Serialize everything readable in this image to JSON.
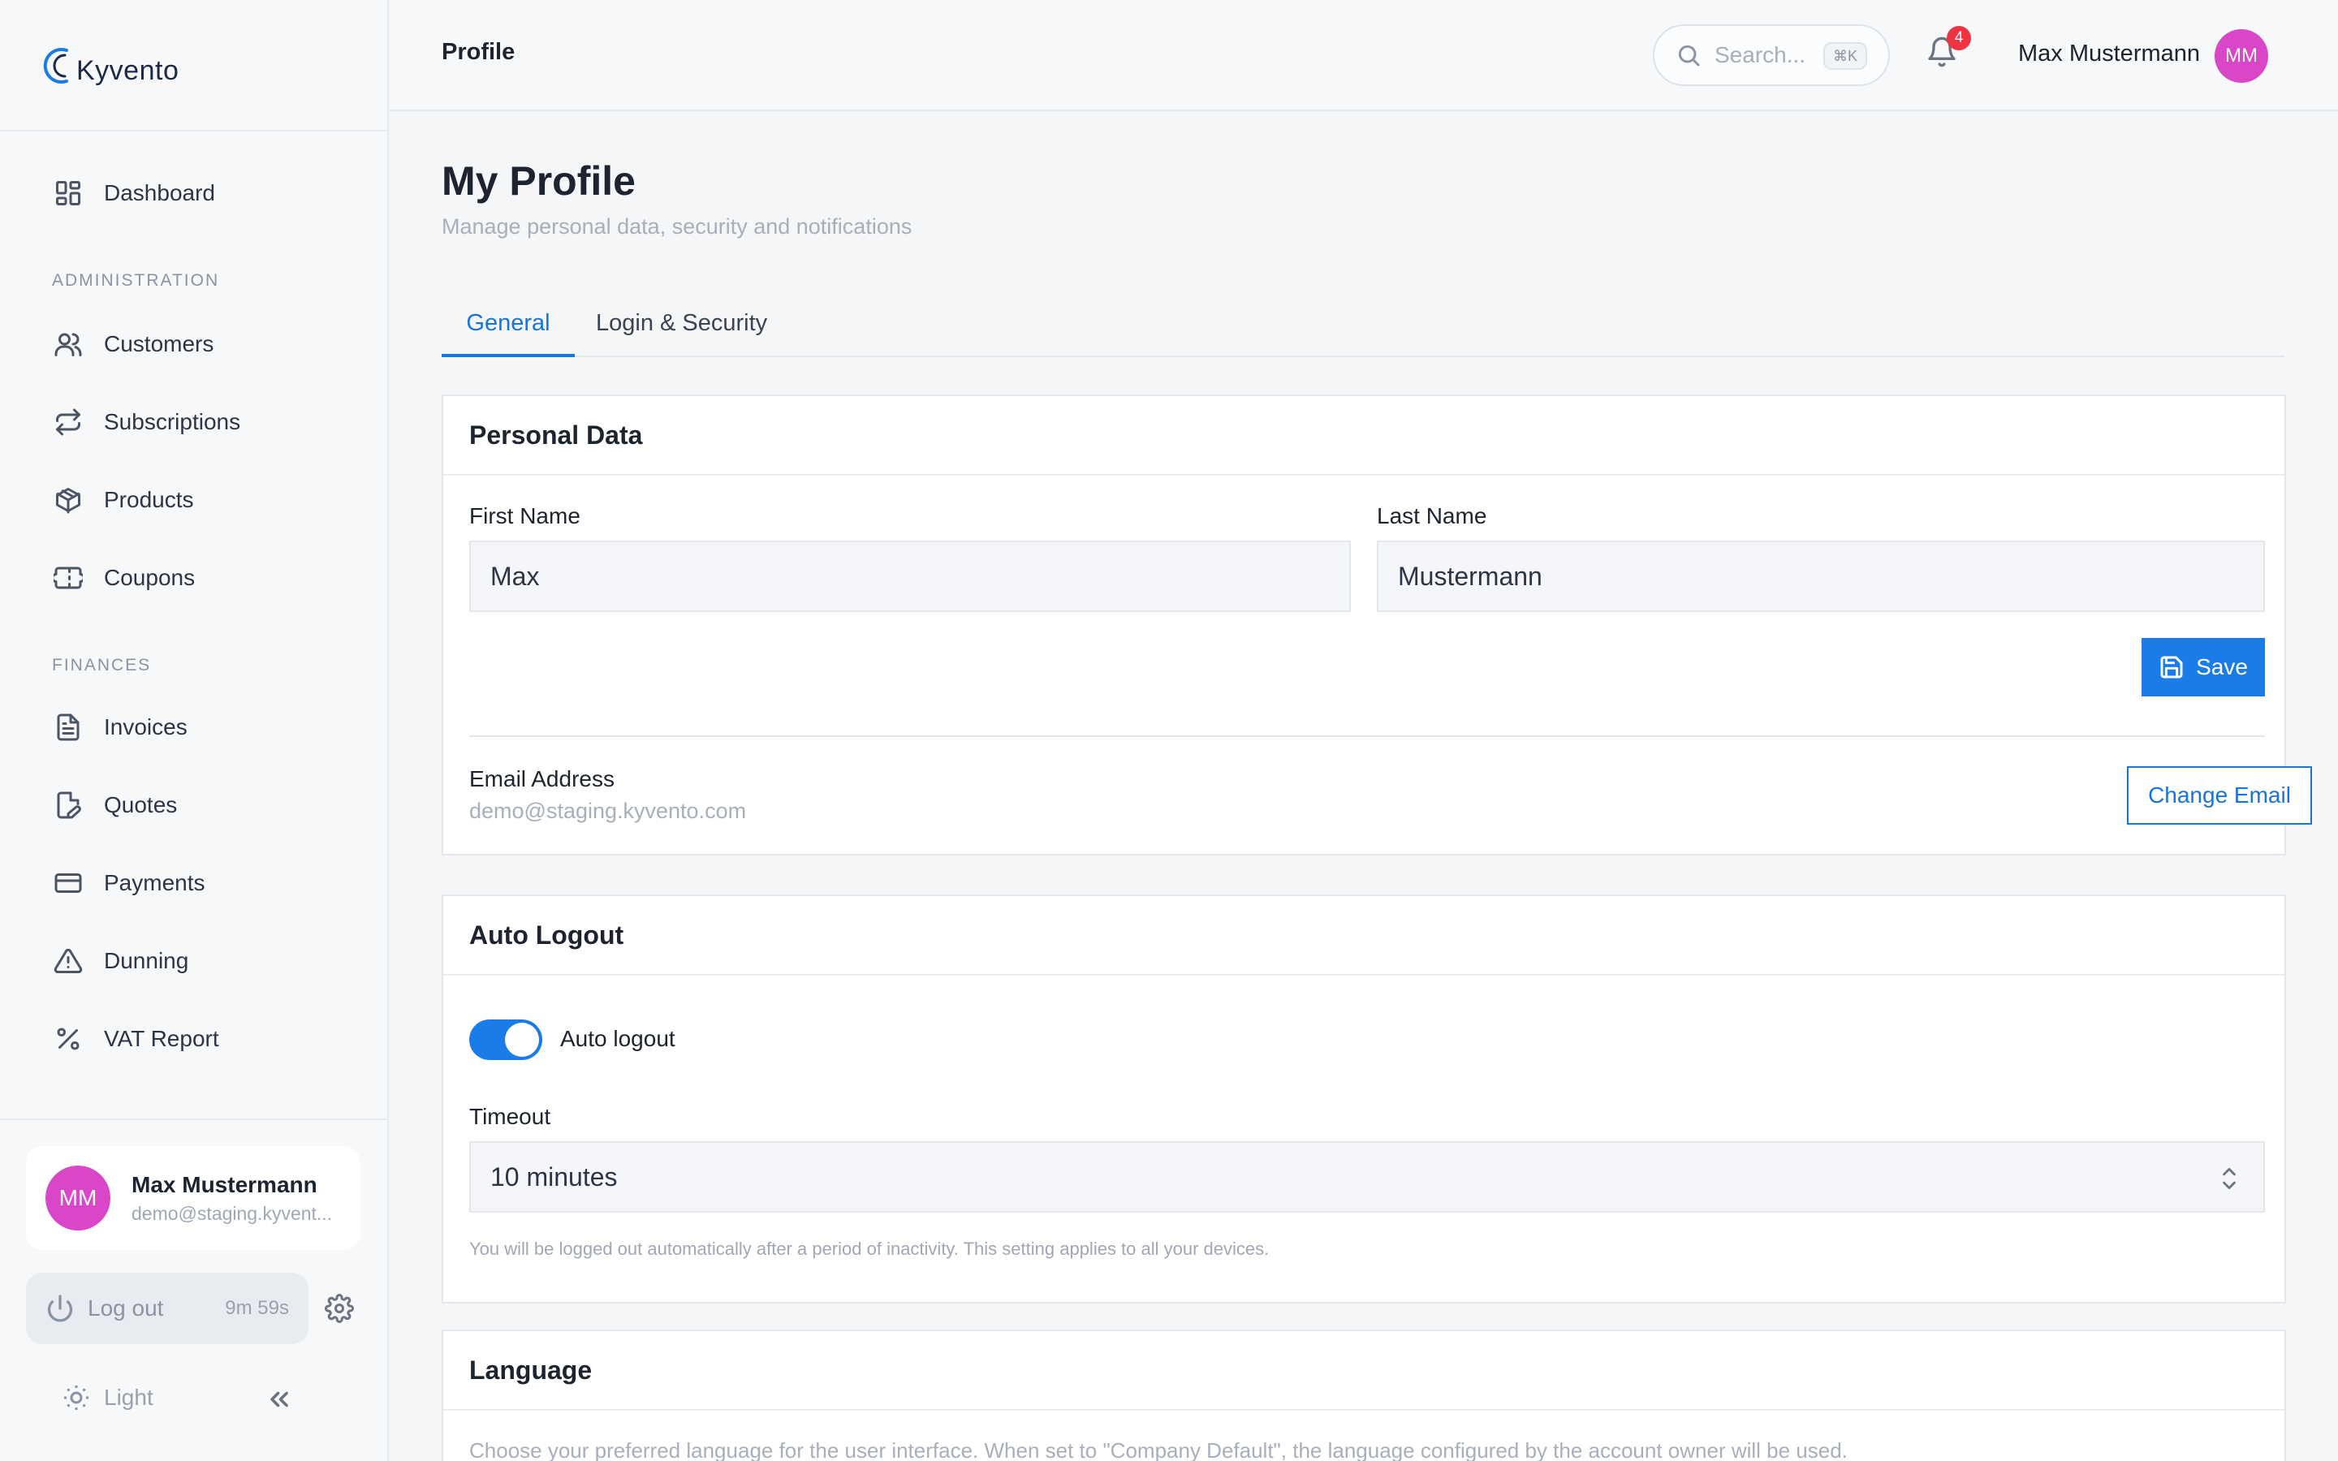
{
  "app": {
    "name": "Kyvento"
  },
  "sidebar": {
    "items": [
      {
        "label": "Dashboard",
        "icon": "dashboard-icon"
      },
      {
        "label": "Customers",
        "icon": "users-icon"
      },
      {
        "label": "Subscriptions",
        "icon": "repeat-icon"
      },
      {
        "label": "Products",
        "icon": "box-icon"
      },
      {
        "label": "Coupons",
        "icon": "ticket-icon"
      },
      {
        "label": "Invoices",
        "icon": "file-text-icon"
      },
      {
        "label": "Quotes",
        "icon": "file-edit-icon"
      },
      {
        "label": "Payments",
        "icon": "credit-card-icon"
      },
      {
        "label": "Dunning",
        "icon": "alert-triangle-icon"
      },
      {
        "label": "VAT Report",
        "icon": "percent-icon"
      }
    ],
    "sections": {
      "administration": "ADMINISTRATION",
      "finances": "FINANCES"
    },
    "user": {
      "initials": "MM",
      "name": "Max Mustermann",
      "email": "demo@staging.kyvent..."
    },
    "logout": {
      "label": "Log out",
      "timer": "9m 59s"
    },
    "theme": {
      "label": "Light"
    }
  },
  "header": {
    "breadcrumb": "Profile",
    "search": {
      "placeholder": "Search...",
      "shortcut": "⌘K"
    },
    "notifications": {
      "count": "4"
    },
    "user": {
      "name": "Max Mustermann",
      "initials": "MM"
    }
  },
  "page": {
    "title": "My Profile",
    "subtitle": "Manage personal data, security and notifications",
    "tabs": [
      {
        "label": "General",
        "active": true
      },
      {
        "label": "Login & Security",
        "active": false
      }
    ]
  },
  "personal_data": {
    "title": "Personal Data",
    "first_name_label": "First Name",
    "first_name_value": "Max",
    "last_name_label": "Last Name",
    "last_name_value": "Mustermann",
    "save_label": "Save",
    "email_label": "Email Address",
    "email_value": "demo@staging.kyvento.com",
    "change_email_label": "Change Email"
  },
  "auto_logout": {
    "title": "Auto Logout",
    "toggle_label": "Auto logout",
    "enabled": true,
    "timeout_label": "Timeout",
    "timeout_value": "10 minutes",
    "help": "You will be logged out automatically after a period of inactivity. This setting applies to all your devices."
  },
  "language": {
    "title": "Language",
    "description": "Choose your preferred language for the user interface. When set to \"Company Default\", the language configured by the account owner will be used."
  },
  "colors": {
    "accent": "#1a7ce8",
    "avatar": "#d946c7",
    "badge": "#ef3340"
  }
}
